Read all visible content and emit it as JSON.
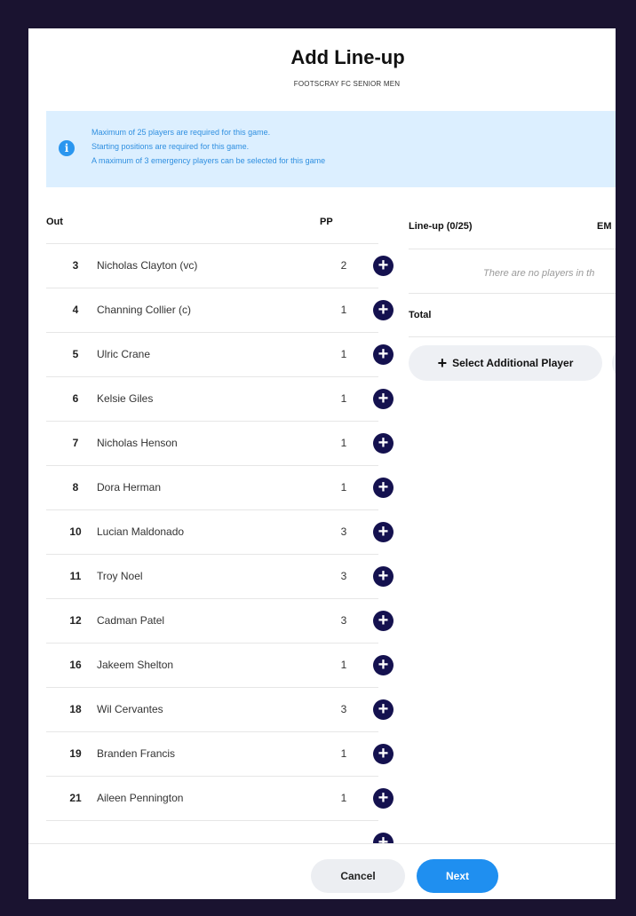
{
  "modal": {
    "title": "Add Line-up",
    "subtitle": "FOOTSCRAY FC SENIOR MEN"
  },
  "info": {
    "icon": "info-icon",
    "lines": [
      "Maximum of 25 players are required for this game.",
      "Starting positions are required for this game.",
      "A maximum of 3 emergency players can be selected for this game"
    ]
  },
  "out_list": {
    "header_out": "Out",
    "header_pp": "PP",
    "players": [
      {
        "number": "3",
        "name": "Nicholas Clayton (vc)",
        "pp": "2"
      },
      {
        "number": "4",
        "name": "Channing Collier (c)",
        "pp": "1"
      },
      {
        "number": "5",
        "name": "Ulric Crane",
        "pp": "1"
      },
      {
        "number": "6",
        "name": "Kelsie Giles",
        "pp": "1"
      },
      {
        "number": "7",
        "name": "Nicholas Henson",
        "pp": "1"
      },
      {
        "number": "8",
        "name": "Dora Herman",
        "pp": "1"
      },
      {
        "number": "10",
        "name": "Lucian Maldonado",
        "pp": "3"
      },
      {
        "number": "11",
        "name": "Troy Noel",
        "pp": "3"
      },
      {
        "number": "12",
        "name": "Cadman Patel",
        "pp": "3"
      },
      {
        "number": "16",
        "name": "Jakeem Shelton",
        "pp": "1"
      },
      {
        "number": "18",
        "name": "Wil Cervantes",
        "pp": "3"
      },
      {
        "number": "19",
        "name": "Branden Francis",
        "pp": "1"
      },
      {
        "number": "21",
        "name": "Aileen Pennington",
        "pp": "1"
      }
    ]
  },
  "lineup": {
    "header": "Line-up (0/25)",
    "em_header": "EM",
    "empty_message": "There are no players in th",
    "total_label": "Total",
    "select_button_label": "Select Additional Player"
  },
  "footer": {
    "cancel_label": "Cancel",
    "next_label": "Next"
  },
  "colors": {
    "backdrop": "#1a1330",
    "info_bg": "#dcefff",
    "info_text": "#2f8fe0",
    "add_button": "#14114f",
    "next_button": "#1f8ff0"
  }
}
